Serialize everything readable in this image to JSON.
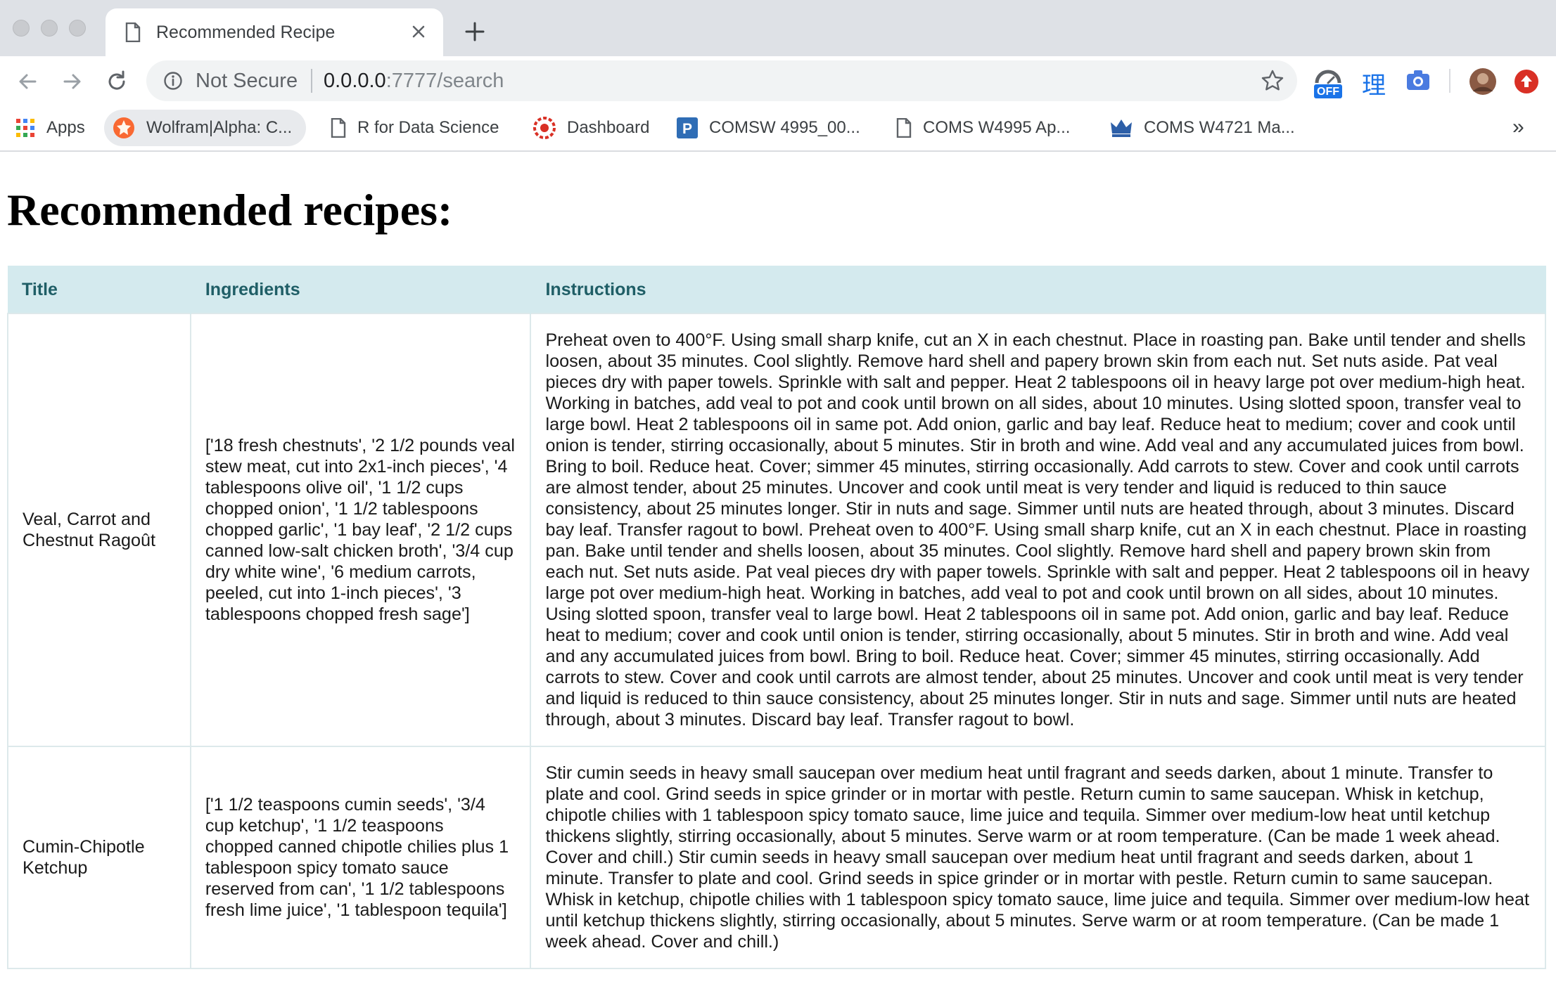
{
  "browser": {
    "tab_title": "Recommended Recipe",
    "security_label": "Not Secure",
    "url_host": "0.0.0.0",
    "url_rest": ":7777/search",
    "badge_text": "OFF",
    "translate_glyph": "理",
    "overflow_glyph": "»"
  },
  "bookmarks": [
    {
      "label": "Apps",
      "icon": "apps-grid-icon"
    },
    {
      "label": "Wolfram|Alpha: C...",
      "icon": "wolfram-icon"
    },
    {
      "label": "R for Data Science",
      "icon": "document-icon"
    },
    {
      "label": "Dashboard",
      "icon": "dashboard-icon"
    },
    {
      "label": "COMSW 4995_00...",
      "icon": "p-icon"
    },
    {
      "label": "COMS W4995 Ap...",
      "icon": "document-icon"
    },
    {
      "label": "COMS W4721 Ma...",
      "icon": "crown-icon"
    }
  ],
  "page": {
    "heading": "Recommended recipes:",
    "columns": [
      "Title",
      "Ingredients",
      "Instructions"
    ],
    "rows": [
      {
        "title": "Veal, Carrot and Chestnut Ragoût",
        "ingredients": "['18 fresh chestnuts', '2 1/2 pounds veal stew meat, cut into 2x1-inch pieces', '4 tablespoons olive oil', '1 1/2 cups chopped onion', '1 1/2 tablespoons chopped garlic', '1 bay leaf', '2 1/2 cups canned low-salt chicken broth', '3/4 cup dry white wine', '6 medium carrots, peeled, cut into 1-inch pieces', '3 tablespoons chopped fresh sage']",
        "instructions": "Preheat oven to 400°F. Using small sharp knife, cut an X in each chestnut. Place in roasting pan. Bake until tender and shells loosen, about 35 minutes. Cool slightly. Remove hard shell and papery brown skin from each nut. Set nuts aside. Pat veal pieces dry with paper towels. Sprinkle with salt and pepper. Heat 2 tablespoons oil in heavy large pot over medium-high heat. Working in batches, add veal to pot and cook until brown on all sides, about 10 minutes. Using slotted spoon, transfer veal to large bowl. Heat 2 tablespoons oil in same pot. Add onion, garlic and bay leaf. Reduce heat to medium; cover and cook until onion is tender, stirring occasionally, about 5 minutes. Stir in broth and wine. Add veal and any accumulated juices from bowl. Bring to boil. Reduce heat. Cover; simmer 45 minutes, stirring occasionally. Add carrots to stew. Cover and cook until carrots are almost tender, about 25 minutes. Uncover and cook until meat is very tender and liquid is reduced to thin sauce consistency, about 25 minutes longer. Stir in nuts and sage. Simmer until nuts are heated through, about 3 minutes. Discard bay leaf. Transfer ragout to bowl. Preheat oven to 400°F. Using small sharp knife, cut an X in each chestnut. Place in roasting pan. Bake until tender and shells loosen, about 35 minutes. Cool slightly. Remove hard shell and papery brown skin from each nut. Set nuts aside. Pat veal pieces dry with paper towels. Sprinkle with salt and pepper. Heat 2 tablespoons oil in heavy large pot over medium-high heat. Working in batches, add veal to pot and cook until brown on all sides, about 10 minutes. Using slotted spoon, transfer veal to large bowl. Heat 2 tablespoons oil in same pot. Add onion, garlic and bay leaf. Reduce heat to medium; cover and cook until onion is tender, stirring occasionally, about 5 minutes. Stir in broth and wine. Add veal and any accumulated juices from bowl. Bring to boil. Reduce heat. Cover; simmer 45 minutes, stirring occasionally. Add carrots to stew. Cover and cook until carrots are almost tender, about 25 minutes. Uncover and cook until meat is very tender and liquid is reduced to thin sauce consistency, about 25 minutes longer. Stir in nuts and sage. Simmer until nuts are heated through, about 3 minutes. Discard bay leaf. Transfer ragout to bowl."
      },
      {
        "title": "Cumin-Chipotle Ketchup",
        "ingredients": "['1 1/2 teaspoons cumin seeds', '3/4 cup ketchup', '1 1/2 teaspoons chopped canned chipotle chilies plus 1 tablespoon spicy tomato sauce reserved from can', '1 1/2 tablespoons fresh lime juice', '1 tablespoon tequila']",
        "instructions": "Stir cumin seeds in heavy small saucepan over medium heat until fragrant and seeds darken, about 1 minute. Transfer to plate and cool. Grind seeds in spice grinder or in mortar with pestle. Return cumin to same saucepan. Whisk in ketchup, chipotle chilies with 1 tablespoon spicy tomato sauce, lime juice and tequila. Simmer over medium-low heat until ketchup thickens slightly, stirring occasionally, about 5 minutes. Serve warm or at room temperature. (Can be made 1 week ahead. Cover and chill.) Stir cumin seeds in heavy small saucepan over medium heat until fragrant and seeds darken, about 1 minute. Transfer to plate and cool. Grind seeds in spice grinder or in mortar with pestle. Return cumin to same saucepan. Whisk in ketchup, chipotle chilies with 1 tablespoon spicy tomato sauce, lime juice and tequila. Simmer over medium-low heat until ketchup thickens slightly, stirring occasionally, about 5 minutes. Serve warm or at room temperature. (Can be made 1 week ahead. Cover and chill.)"
      }
    ]
  },
  "colors": {
    "header_bg": "#d4eaee",
    "header_text": "#1f5e66",
    "tabstrip_bg": "#dee1e6"
  }
}
